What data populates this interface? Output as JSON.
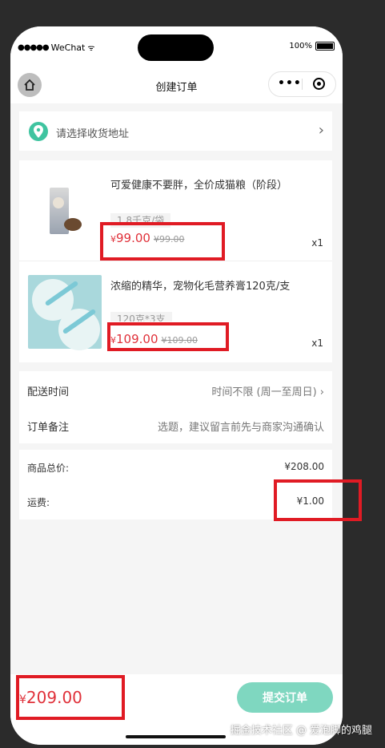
{
  "status_bar": {
    "signal": "●●●●●",
    "carrier": "WeChat",
    "wifi": "ᯤ",
    "battery": "100%"
  },
  "nav": {
    "title": "创建订单",
    "more": "•••"
  },
  "address": {
    "placeholder": "请选择收货地址",
    "chevron": "›"
  },
  "goods": [
    {
      "name": "可爱健康不要胖，全价成猫粮（阶段）",
      "spec": "1.8千克/袋",
      "price_symbol": "¥",
      "price": "99.00",
      "original_price": "¥99.00",
      "qty": "x1",
      "image": "cat-food-bag"
    },
    {
      "name": "浓缩的精华，宠物化毛营养膏120克/支",
      "spec": "120克*3支",
      "price_symbol": "¥",
      "price": "109.00",
      "original_price": "¥109.00",
      "qty": "x1",
      "image": "nutrition-paste"
    }
  ],
  "delivery": {
    "time_label": "配送时间",
    "time_value": "时间不限 (周一至周日) ›",
    "note_label": "订单备注",
    "note_value": "选题，建议留言前先与商家沟通确认"
  },
  "totals": {
    "goods_label": "商品总价:",
    "goods_value": "¥208.00",
    "shipping_label": "运费:",
    "shipping_value": "¥1.00"
  },
  "bottom": {
    "price_symbol": "¥",
    "total": "209.00",
    "submit_label": "提交订单"
  },
  "watermark": "掘金技术社区 @ 爱泡脚的鸡腿",
  "colors": {
    "price_red": "#e0313a",
    "accent_green": "#3fc4a0",
    "submit_green": "#7fd7c0",
    "annotation_red": "#e01b24"
  }
}
